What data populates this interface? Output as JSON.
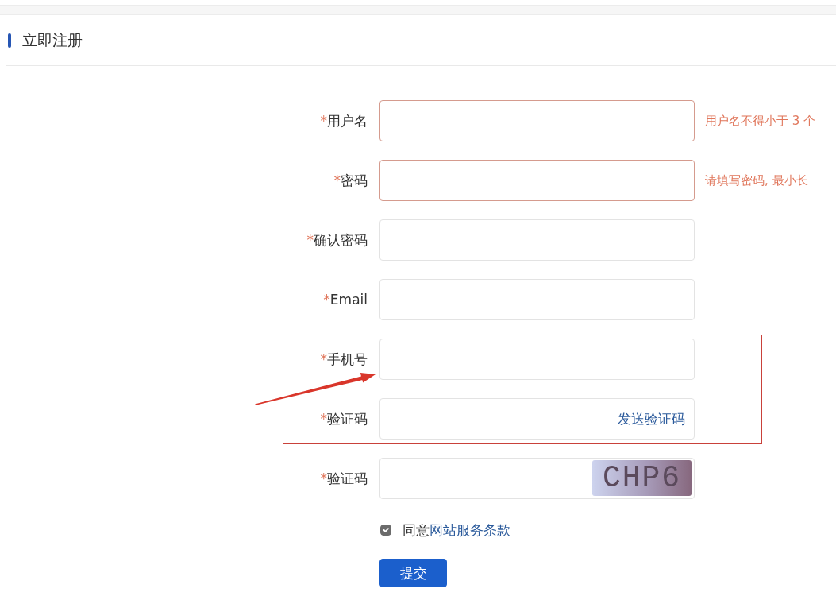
{
  "page": {
    "title": "立即注册"
  },
  "form": {
    "fields": [
      {
        "mark": "*",
        "label": "用户名",
        "kind": "text",
        "invalid": true,
        "hint": "用户名不得小于 3 个",
        "highlighted": false
      },
      {
        "mark": "*",
        "label": "密码",
        "kind": "password",
        "invalid": true,
        "hint": "请填写密码, 最小长",
        "highlighted": false
      },
      {
        "mark": "*",
        "label": "确认密码",
        "kind": "password",
        "invalid": false,
        "highlighted": false
      },
      {
        "mark": "*",
        "label": "Email",
        "kind": "text",
        "invalid": false,
        "highlighted": false
      },
      {
        "mark": "*",
        "label": "手机号",
        "kind": "text",
        "invalid": false,
        "highlighted": true
      },
      {
        "mark": "*",
        "label": "验证码",
        "kind": "sms_code",
        "action": "发送验证码",
        "invalid": false,
        "highlighted": true
      },
      {
        "mark": "*",
        "label": "验证码",
        "kind": "captcha",
        "captcha": "CHP6",
        "invalid": false,
        "highlighted": false
      }
    ]
  },
  "agreement": {
    "checked": true,
    "text": "同意",
    "link": "网站服务条款"
  },
  "submit": {
    "label": "提交"
  },
  "annotation": {
    "arrow": true
  }
}
